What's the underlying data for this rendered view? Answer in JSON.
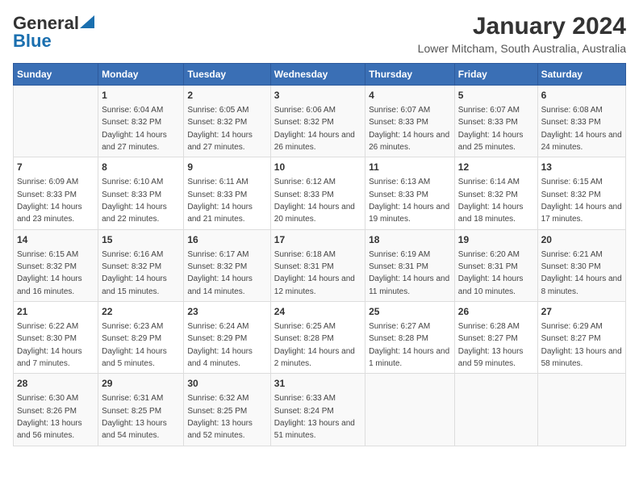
{
  "logo": {
    "text_general": "General",
    "text_blue": "Blue"
  },
  "header": {
    "title": "January 2024",
    "subtitle": "Lower Mitcham, South Australia, Australia"
  },
  "weekdays": [
    "Sunday",
    "Monday",
    "Tuesday",
    "Wednesday",
    "Thursday",
    "Friday",
    "Saturday"
  ],
  "weeks": [
    [
      {
        "day": "",
        "sunrise": "",
        "sunset": "",
        "daylight": ""
      },
      {
        "day": "1",
        "sunrise": "Sunrise: 6:04 AM",
        "sunset": "Sunset: 8:32 PM",
        "daylight": "Daylight: 14 hours and 27 minutes."
      },
      {
        "day": "2",
        "sunrise": "Sunrise: 6:05 AM",
        "sunset": "Sunset: 8:32 PM",
        "daylight": "Daylight: 14 hours and 27 minutes."
      },
      {
        "day": "3",
        "sunrise": "Sunrise: 6:06 AM",
        "sunset": "Sunset: 8:32 PM",
        "daylight": "Daylight: 14 hours and 26 minutes."
      },
      {
        "day": "4",
        "sunrise": "Sunrise: 6:07 AM",
        "sunset": "Sunset: 8:33 PM",
        "daylight": "Daylight: 14 hours and 26 minutes."
      },
      {
        "day": "5",
        "sunrise": "Sunrise: 6:07 AM",
        "sunset": "Sunset: 8:33 PM",
        "daylight": "Daylight: 14 hours and 25 minutes."
      },
      {
        "day": "6",
        "sunrise": "Sunrise: 6:08 AM",
        "sunset": "Sunset: 8:33 PM",
        "daylight": "Daylight: 14 hours and 24 minutes."
      }
    ],
    [
      {
        "day": "7",
        "sunrise": "Sunrise: 6:09 AM",
        "sunset": "Sunset: 8:33 PM",
        "daylight": "Daylight: 14 hours and 23 minutes."
      },
      {
        "day": "8",
        "sunrise": "Sunrise: 6:10 AM",
        "sunset": "Sunset: 8:33 PM",
        "daylight": "Daylight: 14 hours and 22 minutes."
      },
      {
        "day": "9",
        "sunrise": "Sunrise: 6:11 AM",
        "sunset": "Sunset: 8:33 PM",
        "daylight": "Daylight: 14 hours and 21 minutes."
      },
      {
        "day": "10",
        "sunrise": "Sunrise: 6:12 AM",
        "sunset": "Sunset: 8:33 PM",
        "daylight": "Daylight: 14 hours and 20 minutes."
      },
      {
        "day": "11",
        "sunrise": "Sunrise: 6:13 AM",
        "sunset": "Sunset: 8:33 PM",
        "daylight": "Daylight: 14 hours and 19 minutes."
      },
      {
        "day": "12",
        "sunrise": "Sunrise: 6:14 AM",
        "sunset": "Sunset: 8:32 PM",
        "daylight": "Daylight: 14 hours and 18 minutes."
      },
      {
        "day": "13",
        "sunrise": "Sunrise: 6:15 AM",
        "sunset": "Sunset: 8:32 PM",
        "daylight": "Daylight: 14 hours and 17 minutes."
      }
    ],
    [
      {
        "day": "14",
        "sunrise": "Sunrise: 6:15 AM",
        "sunset": "Sunset: 8:32 PM",
        "daylight": "Daylight: 14 hours and 16 minutes."
      },
      {
        "day": "15",
        "sunrise": "Sunrise: 6:16 AM",
        "sunset": "Sunset: 8:32 PM",
        "daylight": "Daylight: 14 hours and 15 minutes."
      },
      {
        "day": "16",
        "sunrise": "Sunrise: 6:17 AM",
        "sunset": "Sunset: 8:32 PM",
        "daylight": "Daylight: 14 hours and 14 minutes."
      },
      {
        "day": "17",
        "sunrise": "Sunrise: 6:18 AM",
        "sunset": "Sunset: 8:31 PM",
        "daylight": "Daylight: 14 hours and 12 minutes."
      },
      {
        "day": "18",
        "sunrise": "Sunrise: 6:19 AM",
        "sunset": "Sunset: 8:31 PM",
        "daylight": "Daylight: 14 hours and 11 minutes."
      },
      {
        "day": "19",
        "sunrise": "Sunrise: 6:20 AM",
        "sunset": "Sunset: 8:31 PM",
        "daylight": "Daylight: 14 hours and 10 minutes."
      },
      {
        "day": "20",
        "sunrise": "Sunrise: 6:21 AM",
        "sunset": "Sunset: 8:30 PM",
        "daylight": "Daylight: 14 hours and 8 minutes."
      }
    ],
    [
      {
        "day": "21",
        "sunrise": "Sunrise: 6:22 AM",
        "sunset": "Sunset: 8:30 PM",
        "daylight": "Daylight: 14 hours and 7 minutes."
      },
      {
        "day": "22",
        "sunrise": "Sunrise: 6:23 AM",
        "sunset": "Sunset: 8:29 PM",
        "daylight": "Daylight: 14 hours and 5 minutes."
      },
      {
        "day": "23",
        "sunrise": "Sunrise: 6:24 AM",
        "sunset": "Sunset: 8:29 PM",
        "daylight": "Daylight: 14 hours and 4 minutes."
      },
      {
        "day": "24",
        "sunrise": "Sunrise: 6:25 AM",
        "sunset": "Sunset: 8:28 PM",
        "daylight": "Daylight: 14 hours and 2 minutes."
      },
      {
        "day": "25",
        "sunrise": "Sunrise: 6:27 AM",
        "sunset": "Sunset: 8:28 PM",
        "daylight": "Daylight: 14 hours and 1 minute."
      },
      {
        "day": "26",
        "sunrise": "Sunrise: 6:28 AM",
        "sunset": "Sunset: 8:27 PM",
        "daylight": "Daylight: 13 hours and 59 minutes."
      },
      {
        "day": "27",
        "sunrise": "Sunrise: 6:29 AM",
        "sunset": "Sunset: 8:27 PM",
        "daylight": "Daylight: 13 hours and 58 minutes."
      }
    ],
    [
      {
        "day": "28",
        "sunrise": "Sunrise: 6:30 AM",
        "sunset": "Sunset: 8:26 PM",
        "daylight": "Daylight: 13 hours and 56 minutes."
      },
      {
        "day": "29",
        "sunrise": "Sunrise: 6:31 AM",
        "sunset": "Sunset: 8:25 PM",
        "daylight": "Daylight: 13 hours and 54 minutes."
      },
      {
        "day": "30",
        "sunrise": "Sunrise: 6:32 AM",
        "sunset": "Sunset: 8:25 PM",
        "daylight": "Daylight: 13 hours and 52 minutes."
      },
      {
        "day": "31",
        "sunrise": "Sunrise: 6:33 AM",
        "sunset": "Sunset: 8:24 PM",
        "daylight": "Daylight: 13 hours and 51 minutes."
      },
      {
        "day": "",
        "sunrise": "",
        "sunset": "",
        "daylight": ""
      },
      {
        "day": "",
        "sunrise": "",
        "sunset": "",
        "daylight": ""
      },
      {
        "day": "",
        "sunrise": "",
        "sunset": "",
        "daylight": ""
      }
    ]
  ]
}
